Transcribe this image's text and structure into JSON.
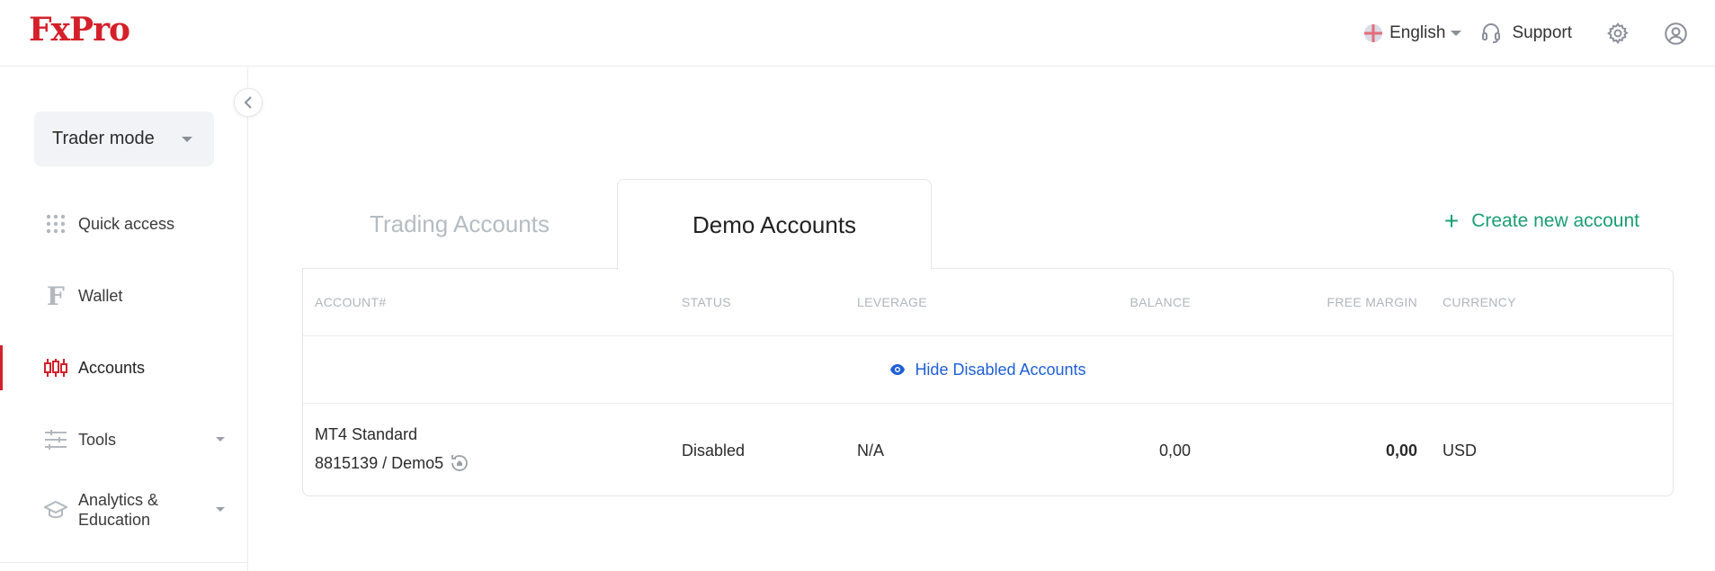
{
  "brand": {
    "logo": "FxPro",
    "accent": "#d4202a"
  },
  "header": {
    "language": "English",
    "support": "Support",
    "icons": [
      "globe-flag-icon",
      "headset-icon",
      "gear-icon",
      "user-icon"
    ]
  },
  "sidebar": {
    "mode": "Trader mode",
    "items": [
      {
        "label": "Quick access",
        "icon": "grid-icon"
      },
      {
        "label": "Wallet",
        "icon": "wallet-f-icon"
      },
      {
        "label": "Accounts",
        "icon": "candlestick-icon",
        "active": true
      },
      {
        "label": "Tools",
        "icon": "sliders-icon"
      },
      {
        "label": "Analytics &",
        "label2": "Education",
        "icon": "graduation-cap-icon"
      }
    ]
  },
  "tabs": {
    "trading": "Trading Accounts",
    "demo": "Demo Accounts",
    "active": "Demo Accounts"
  },
  "create_account": "Create new account",
  "table": {
    "columns": [
      "ACCOUNT#",
      "STATUS",
      "LEVERAGE",
      "BALANCE",
      "FREE MARGIN",
      "CURRENCY"
    ],
    "hide_disabled": "Hide Disabled Accounts",
    "rows": [
      {
        "account_type": "MT4 Standard",
        "account_id": "8815139 / Demo5",
        "status": "Disabled",
        "leverage": "N/A",
        "balance": "0,00",
        "free_margin": "0,00",
        "currency": "USD"
      }
    ]
  }
}
